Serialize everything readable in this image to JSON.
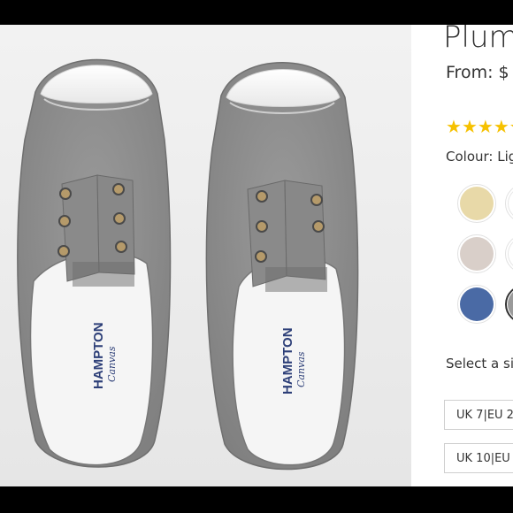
{
  "product": {
    "title": "Plum",
    "price": "From: $",
    "rating_stars": [
      "★",
      "★",
      "★",
      "★",
      "★"
    ],
    "colour_label": "Colour: Lig",
    "swatches": [
      {
        "name": "gold",
        "color": "#e8d9a8"
      },
      {
        "name": "white",
        "color": "#ffffff"
      },
      {
        "name": "stone",
        "color": "#d9cfc9"
      },
      {
        "name": "white-2",
        "color": "#ffffff"
      },
      {
        "name": "denim",
        "color": "#4a6aa5"
      },
      {
        "name": "light-grey-selected",
        "color": "#9a9a9a"
      }
    ],
    "select_size_label": "Select a si",
    "sizes": [
      "UK 7|EU 2",
      "UK 10|EU"
    ]
  },
  "photo": {
    "insole_brand": "HAMPTON",
    "insole_sub": "Canvas",
    "shoe_color": "#8e8e8e",
    "toe_color": "#f7f7f7"
  }
}
